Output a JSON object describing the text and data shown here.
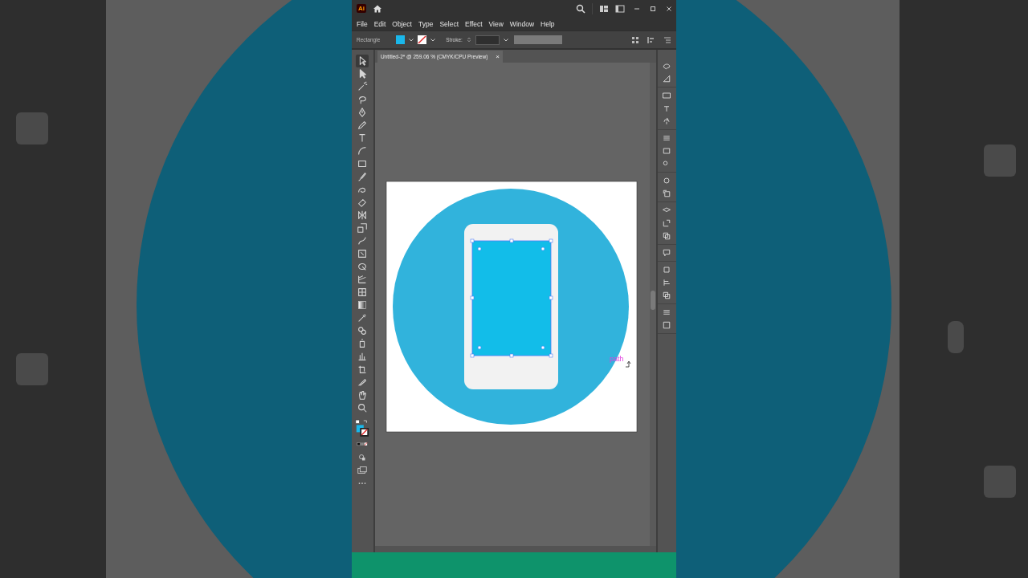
{
  "app": {
    "logo": "Ai"
  },
  "menu": [
    "File",
    "Edit",
    "Object",
    "Type",
    "Select",
    "Effect",
    "View",
    "Window",
    "Help"
  ],
  "control_bar": {
    "tool_name": "Rectangle",
    "stroke_label": "Stroke:"
  },
  "document_tab": {
    "title": "Untitled-2* @ 259.06 % (CMYK/CPU Preview)",
    "close": "×"
  },
  "tools": [
    {
      "kind": "selection",
      "selected": true
    },
    {
      "kind": "direct",
      "selected": false
    },
    {
      "kind": "wand",
      "selected": false
    },
    {
      "kind": "lasso",
      "selected": false
    },
    {
      "kind": "pen",
      "selected": false
    },
    {
      "kind": "pencil",
      "selected": false
    },
    {
      "kind": "type",
      "selected": false
    },
    {
      "kind": "arc",
      "selected": false
    },
    {
      "kind": "rectangle",
      "selected": false
    },
    {
      "kind": "brush",
      "selected": false
    },
    {
      "kind": "shaper",
      "selected": false
    },
    {
      "kind": "eraser",
      "selected": false
    },
    {
      "kind": "reflect",
      "selected": false
    },
    {
      "kind": "scale",
      "selected": false
    },
    {
      "kind": "warp",
      "selected": false
    },
    {
      "kind": "free",
      "selected": false
    },
    {
      "kind": "builder",
      "selected": false
    },
    {
      "kind": "perspective",
      "selected": false
    },
    {
      "kind": "mesh",
      "selected": false
    },
    {
      "kind": "gradient",
      "selected": false
    },
    {
      "kind": "eyedropper",
      "selected": false
    },
    {
      "kind": "blend",
      "selected": false
    },
    {
      "kind": "symbol",
      "selected": false
    },
    {
      "kind": "graph",
      "selected": false
    },
    {
      "kind": "artboard",
      "selected": false
    },
    {
      "kind": "slice",
      "selected": false
    },
    {
      "kind": "hand",
      "selected": false
    },
    {
      "kind": "zoom",
      "selected": false
    }
  ],
  "smart_guide": "path"
}
